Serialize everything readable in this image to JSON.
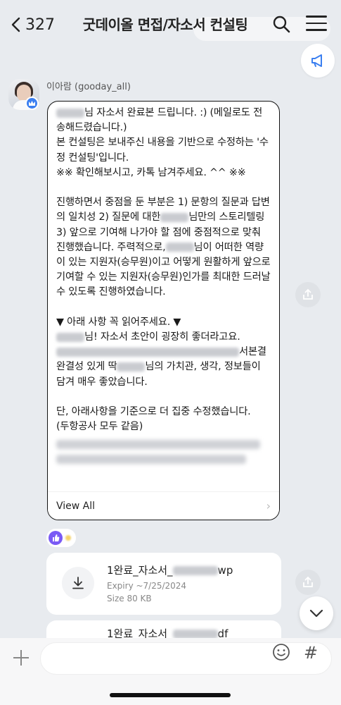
{
  "header": {
    "back_count": "327",
    "title": "굿데이올 면접/자소서 컨설팅"
  },
  "sender": {
    "name": "이아람 (gooday_all)"
  },
  "message": {
    "line1": "님 자소서 완료본 드립니다. :) (메일로도 전송해드렸습니다.)",
    "line2": "본 컨설팅은 보내주신 내용을 기반으로 수정하는 '수정 컨설팅'입니다.",
    "line3": "※※ 확인해보시고, 카톡 남겨주세요. ^^ ※※",
    "p2_a": "진행하면서 중점을 둔 부분은 1) 문항의 질문과 답변의 일치성 2) 질문에 대한",
    "p2_b": "님만의 스토리텔링 3) 앞으로 기여해 나가야 할 점에 중점적으로 맞춰 진행했습니다. 주력적으로,",
    "p2_c": "님이 어떠한 역량이 있는 지원자(승무원)이고 어떻게 원활하게 앞으로 기여할 수 있는 지원자(승무원)인가를 최대한 드러날 수 있도록 진행하였습니다.",
    "p3_title": "▼ 아래 사항 꼭 읽어주세요. ▼",
    "p3_a": "님! 자소서 초안이 굉장히 좋더라고요.",
    "p3_b": "서본결",
    "p3_c": "완결성 있게 딱",
    "p3_d": "님의 가치관, 생각, 정보들이 담겨 매우 좋았습니다.",
    "p4_a": "단, 아래사항을 기준으로 더 집중 수정했습니다.",
    "p4_b": "(두항공사 모두 같음)",
    "view_all": "View All"
  },
  "files": [
    {
      "name": "1완료_자소서_",
      "ext": "wp",
      "expiry": "Expiry ~7/25/2024",
      "size": "Size  80 KB"
    },
    {
      "name": "1완료_자소서_",
      "ext": "df"
    }
  ],
  "icons": {
    "back": "chevron-left-icon",
    "search": "search-icon",
    "menu": "hamburger-menu-icon",
    "announce": "megaphone-icon",
    "share": "share-icon",
    "download": "download-icon",
    "scroll_down": "chevron-down-icon",
    "plus": "plus-icon",
    "emoji": "emoji-icon",
    "hash": "hash-icon"
  },
  "bottom": {
    "hash": "#"
  },
  "colors": {
    "background": "#e8ebef",
    "badge_blue": "#3b7ff0",
    "reaction_purple": "#7a5af5"
  }
}
